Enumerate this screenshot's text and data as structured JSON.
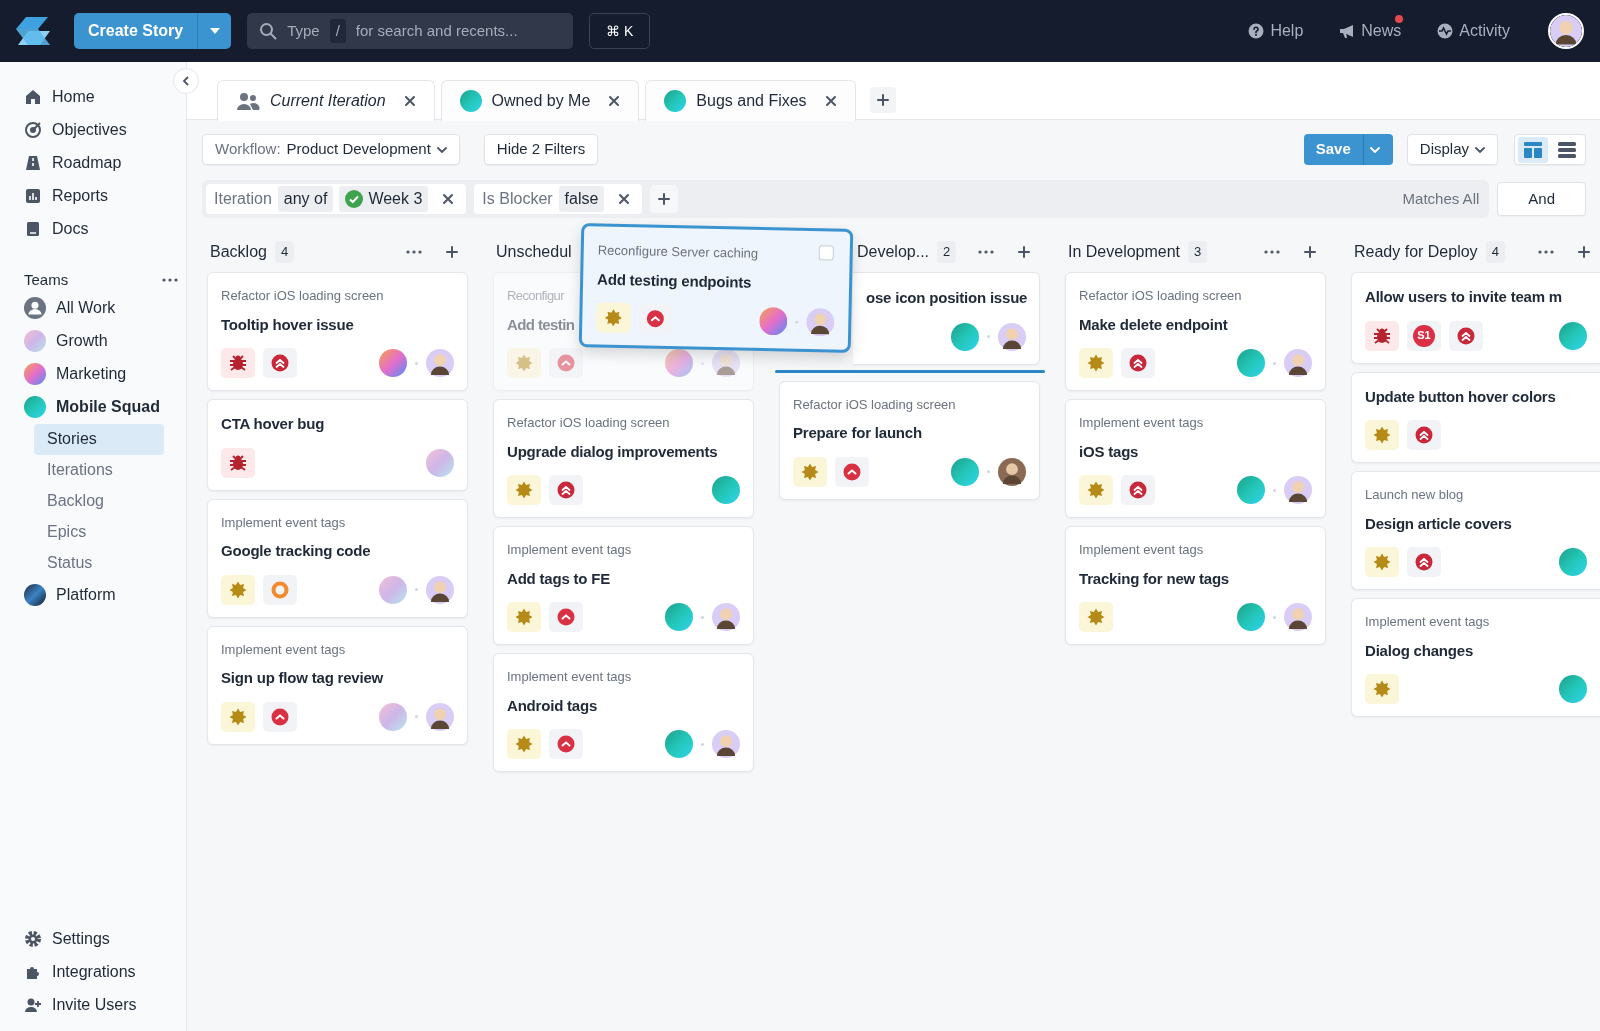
{
  "topbar": {
    "create_button": "Create Story",
    "search": {
      "prefix": "Type",
      "key": "/",
      "placeholder": "for search and recents..."
    },
    "shortcut": "⌘ K",
    "links": [
      {
        "kind": "help",
        "label": "Help",
        "unread": false
      },
      {
        "kind": "news",
        "label": "News",
        "unread": true
      },
      {
        "kind": "activity",
        "label": "Activity",
        "unread": false
      }
    ]
  },
  "sidebar": {
    "items": [
      {
        "kind": "home",
        "label": "Home"
      },
      {
        "kind": "objectives",
        "label": "Objectives"
      },
      {
        "kind": "roadmap",
        "label": "Roadmap"
      },
      {
        "kind": "reports",
        "label": "Reports"
      },
      {
        "kind": "docs",
        "label": "Docs"
      }
    ],
    "teams_label": "Teams",
    "teams": [
      {
        "kind": "people",
        "label": "All Work",
        "expanded": false
      },
      {
        "kind": "pastel",
        "label": "Growth",
        "expanded": false
      },
      {
        "kind": "sunset",
        "label": "Marketing",
        "expanded": false
      },
      {
        "kind": "teal",
        "label": "Mobile Squad",
        "expanded": true,
        "children": [
          {
            "label": "Stories",
            "selected": true
          },
          {
            "label": "Iterations",
            "selected": false
          },
          {
            "label": "Backlog",
            "selected": false
          },
          {
            "label": "Epics",
            "selected": false
          },
          {
            "label": "Status",
            "selected": false
          }
        ]
      },
      {
        "kind": "dark",
        "label": "Platform",
        "expanded": false
      }
    ],
    "footer": [
      {
        "kind": "settings",
        "label": "Settings"
      },
      {
        "kind": "puzzle",
        "label": "Integrations"
      },
      {
        "kind": "invite",
        "label": "Invite Users"
      }
    ]
  },
  "tabs": [
    {
      "kind": "people",
      "label": "Current Iteration",
      "selected": true
    },
    {
      "kind": "teal",
      "label": "Owned by Me",
      "selected": false
    },
    {
      "kind": "teal",
      "label": "Bugs and Fixes",
      "selected": false
    }
  ],
  "toolbar": {
    "workflow_label": "Workflow:",
    "workflow": "Product Development",
    "hide_filters": "Hide 2 Filters",
    "save": "Save",
    "display": "Display",
    "views": [
      {
        "kind": "board",
        "selected": true
      },
      {
        "kind": "list",
        "selected": false
      }
    ]
  },
  "filters": [
    {
      "field": "Iteration",
      "operator": "any of",
      "value": "Week 3",
      "done": true
    },
    {
      "field": "Is Blocker",
      "value": "false",
      "done": false
    }
  ],
  "matches": "Matches All",
  "conjunction": "And",
  "columns": [
    {
      "title": "Backlog",
      "count": "4",
      "cards": [
        {
          "epic": "Refactor iOS loading screen",
          "title": "Tooltip hover issue",
          "badges": [
            {
              "kind": "bug"
            },
            {
              "kind": "high"
            }
          ],
          "avatars": [
            {
              "kind": "sunset"
            },
            {
              "kind": "memoji"
            }
          ]
        },
        {
          "title": "CTA hover bug",
          "badges": [
            {
              "kind": "bug"
            }
          ],
          "avatars": [
            {
              "kind": "pastel"
            }
          ]
        },
        {
          "epic": "Implement event tags",
          "title": "Google tracking code",
          "badges": [
            {
              "kind": "feature"
            },
            {
              "kind": "medium"
            }
          ],
          "avatars": [
            {
              "kind": "pastel"
            },
            {
              "kind": "memoji"
            }
          ]
        },
        {
          "epic": "Implement event tags",
          "title": "Sign up flow tag review",
          "badges": [
            {
              "kind": "feature"
            },
            {
              "kind": "raised"
            }
          ],
          "avatars": [
            {
              "kind": "pastel"
            },
            {
              "kind": "memoji"
            }
          ]
        }
      ]
    },
    {
      "title": "Unschedul",
      "cards": [
        {
          "epic": "Reconfigur",
          "title": "Add testin",
          "badges": [
            {
              "kind": "feature"
            },
            {
              "kind": "raised"
            }
          ],
          "avatars": [
            {
              "kind": "sunset"
            },
            {
              "kind": "memoji"
            }
          ],
          "ghost": true
        },
        {
          "epic": "Refactor iOS loading screen",
          "title": "Upgrade dialog improvements",
          "badges": [
            {
              "kind": "feature"
            },
            {
              "kind": "high"
            }
          ],
          "avatars": [
            {
              "kind": "teal"
            }
          ],
          "ghost": false
        },
        {
          "epic": "Implement event tags",
          "title": "Add tags to FE",
          "badges": [
            {
              "kind": "feature"
            },
            {
              "kind": "raised"
            }
          ],
          "avatars": [
            {
              "kind": "teal"
            },
            {
              "kind": "memoji"
            }
          ],
          "ghost": false
        },
        {
          "epic": "Implement event tags",
          "title": "Android tags",
          "badges": [
            {
              "kind": "feature"
            },
            {
              "kind": "raised"
            }
          ],
          "avatars": [
            {
              "kind": "teal"
            },
            {
              "kind": "memoji"
            }
          ],
          "ghost": false
        }
      ]
    },
    {
      "title": "Develop...",
      "count": "2",
      "covered": true,
      "cards": [
        {
          "title": "ose icon position issue",
          "avatars": [
            {
              "kind": "teal"
            },
            {
              "kind": "memoji"
            }
          ],
          "covered": true,
          "drop_below": true
        },
        {
          "epic": "Refactor iOS loading screen",
          "title": "Prepare for launch",
          "badges": [
            {
              "kind": "feature"
            },
            {
              "kind": "raised"
            }
          ],
          "avatars": [
            {
              "kind": "teal"
            },
            {
              "kind": "photo"
            }
          ]
        }
      ]
    },
    {
      "title": "In Development",
      "count": "3",
      "cards": [
        {
          "epic": "Refactor iOS loading screen",
          "title": "Make delete endpoint",
          "badges": [
            {
              "kind": "feature"
            },
            {
              "kind": "high"
            }
          ],
          "avatars": [
            {
              "kind": "teal"
            },
            {
              "kind": "memoji"
            }
          ]
        },
        {
          "epic": "Implement event tags",
          "title": "iOS tags",
          "badges": [
            {
              "kind": "feature"
            },
            {
              "kind": "high"
            }
          ],
          "avatars": [
            {
              "kind": "teal"
            },
            {
              "kind": "memoji"
            }
          ]
        },
        {
          "epic": "Implement event tags",
          "title": "Tracking for new tags",
          "badges": [
            {
              "kind": "feature"
            }
          ],
          "avatars": [
            {
              "kind": "teal"
            },
            {
              "kind": "memoji"
            }
          ]
        }
      ]
    },
    {
      "title": "Ready for Deploy",
      "count": "4",
      "cards": [
        {
          "title": "Allow users to invite team m",
          "badges": [
            {
              "kind": "bug"
            },
            {
              "kind": "severity",
              "label": "S1"
            },
            {
              "kind": "high"
            }
          ],
          "avatars": [
            {
              "kind": "teal"
            }
          ]
        },
        {
          "title": "Update button hover colors",
          "badges": [
            {
              "kind": "feature"
            },
            {
              "kind": "high"
            }
          ]
        },
        {
          "epic": "Launch new blog",
          "title": "Design article covers",
          "badges": [
            {
              "kind": "feature"
            },
            {
              "kind": "high"
            }
          ],
          "avatars": [
            {
              "kind": "teal"
            }
          ]
        },
        {
          "epic": "Implement event tags",
          "title": "Dialog changes",
          "badges": [
            {
              "kind": "feature"
            }
          ],
          "avatars": [
            {
              "kind": "teal"
            }
          ]
        }
      ]
    }
  ],
  "dragged_card": {
    "epic": "Reconfigure Server caching",
    "title": "Add testing endpoints",
    "badges": [
      {
        "kind": "feature"
      },
      {
        "kind": "raised"
      }
    ],
    "avatars": [
      {
        "kind": "sunset"
      },
      {
        "kind": "memoji"
      }
    ],
    "checked": false
  }
}
